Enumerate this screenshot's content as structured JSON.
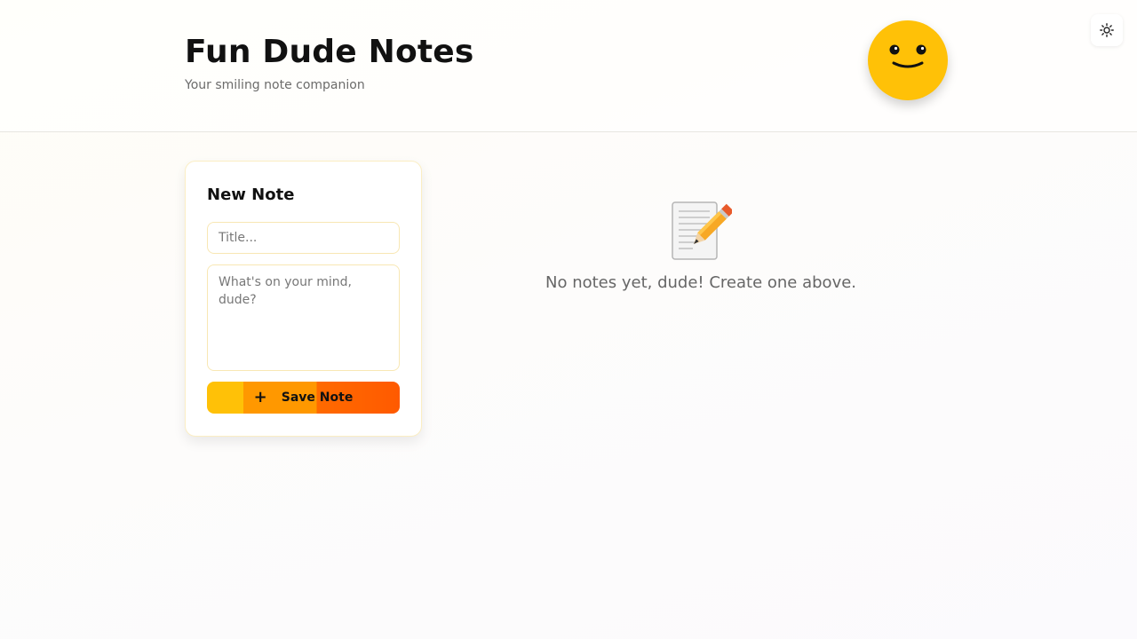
{
  "header": {
    "title": "Fun Dude Notes",
    "subtitle": "Your smiling note companion",
    "mascot_icon": "smiley-face-icon",
    "theme_toggle_icon": "sun-icon"
  },
  "new_note": {
    "heading": "New Note",
    "title_placeholder": "Title...",
    "title_value": "",
    "body_placeholder": "What's on your mind, dude?",
    "body_value": "",
    "save_icon": "plus-icon",
    "save_label": "Save Note"
  },
  "notes_list": {
    "items": [],
    "empty_icon": "memo-pencil-icon",
    "empty_message": "No notes yet, dude! Create one above."
  },
  "colors": {
    "accent_yellow": "#ffc107",
    "accent_orange": "#ff9800",
    "accent_red_orange": "#ff5a00"
  }
}
